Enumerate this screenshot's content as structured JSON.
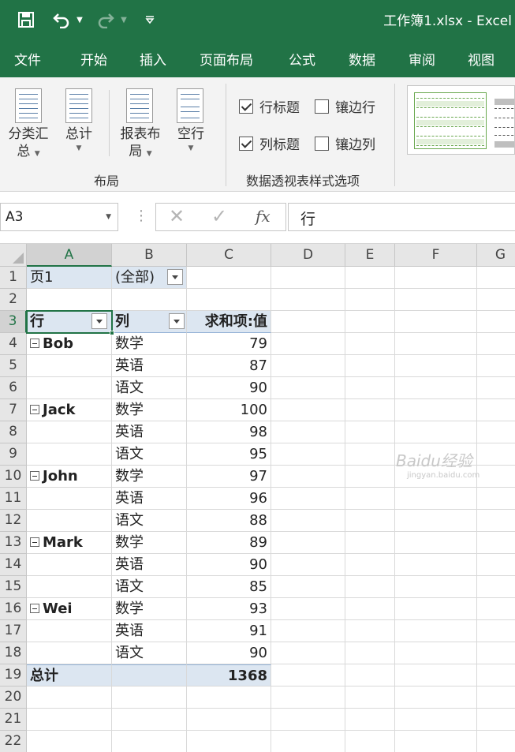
{
  "titlebar": {
    "title": "工作簿1.xlsx  -  Excel",
    "qat": [
      {
        "name": "save-icon",
        "glyph": "💾"
      },
      {
        "name": "undo-icon",
        "glyph": "↶"
      },
      {
        "name": "redo-icon",
        "glyph": "↷"
      },
      {
        "name": "customize-qat-icon",
        "glyph": "▾"
      }
    ]
  },
  "tabs": [
    "文件",
    "开始",
    "插入",
    "页面布局",
    "公式",
    "数据",
    "审阅",
    "视图"
  ],
  "ribbon": {
    "layout_group": {
      "label": "布局",
      "buttons": [
        {
          "line1": "分类汇",
          "line2": "总"
        },
        {
          "line1": "总计",
          "line2": ""
        },
        {
          "line1": "报表布",
          "line2": "局"
        },
        {
          "line1": "空行",
          "line2": ""
        }
      ]
    },
    "style_options_group": {
      "label": "数据透视表样式选项",
      "checkboxes": [
        {
          "label": "行标题",
          "checked": true
        },
        {
          "label": "镶边行",
          "checked": false
        },
        {
          "label": "列标题",
          "checked": true
        },
        {
          "label": "镶边列",
          "checked": false
        }
      ]
    }
  },
  "formula_bar": {
    "name_box": "A3",
    "cancel_glyph": "✕",
    "enter_glyph": "✓",
    "fx_label": "fx",
    "content": "行"
  },
  "grid": {
    "columns": [
      "A",
      "B",
      "C",
      "D",
      "E",
      "F",
      "G"
    ],
    "rows": [
      "1",
      "2",
      "3",
      "4",
      "5",
      "6",
      "7",
      "8",
      "9",
      "10",
      "11",
      "12",
      "13",
      "14",
      "15",
      "16",
      "17",
      "18",
      "19",
      "20",
      "21",
      "22"
    ],
    "page_field": {
      "label": "页1",
      "value": "(全部)"
    },
    "pivot_headers": {
      "row": "行",
      "col": "列",
      "value": "求和项:值"
    },
    "groups": [
      {
        "name": "Bob",
        "items": [
          {
            "subject": "数学",
            "value": "79"
          },
          {
            "subject": "英语",
            "value": "87"
          },
          {
            "subject": "语文",
            "value": "90"
          }
        ]
      },
      {
        "name": "Jack",
        "items": [
          {
            "subject": "数学",
            "value": "100"
          },
          {
            "subject": "英语",
            "value": "98"
          },
          {
            "subject": "语文",
            "value": "95"
          }
        ]
      },
      {
        "name": "John",
        "items": [
          {
            "subject": "数学",
            "value": "97"
          },
          {
            "subject": "英语",
            "value": "96"
          },
          {
            "subject": "语文",
            "value": "88"
          }
        ]
      },
      {
        "name": "Mark",
        "items": [
          {
            "subject": "数学",
            "value": "89"
          },
          {
            "subject": "英语",
            "value": "90"
          },
          {
            "subject": "语文",
            "value": "85"
          }
        ]
      },
      {
        "name": "Wei",
        "items": [
          {
            "subject": "数学",
            "value": "93"
          },
          {
            "subject": "英语",
            "value": "91"
          },
          {
            "subject": "语文",
            "value": "90"
          }
        ]
      }
    ],
    "total": {
      "label": "总计",
      "value": "1368"
    }
  },
  "watermark": {
    "text": "Baidu经验",
    "sub": "jingyan.baidu.com"
  }
}
